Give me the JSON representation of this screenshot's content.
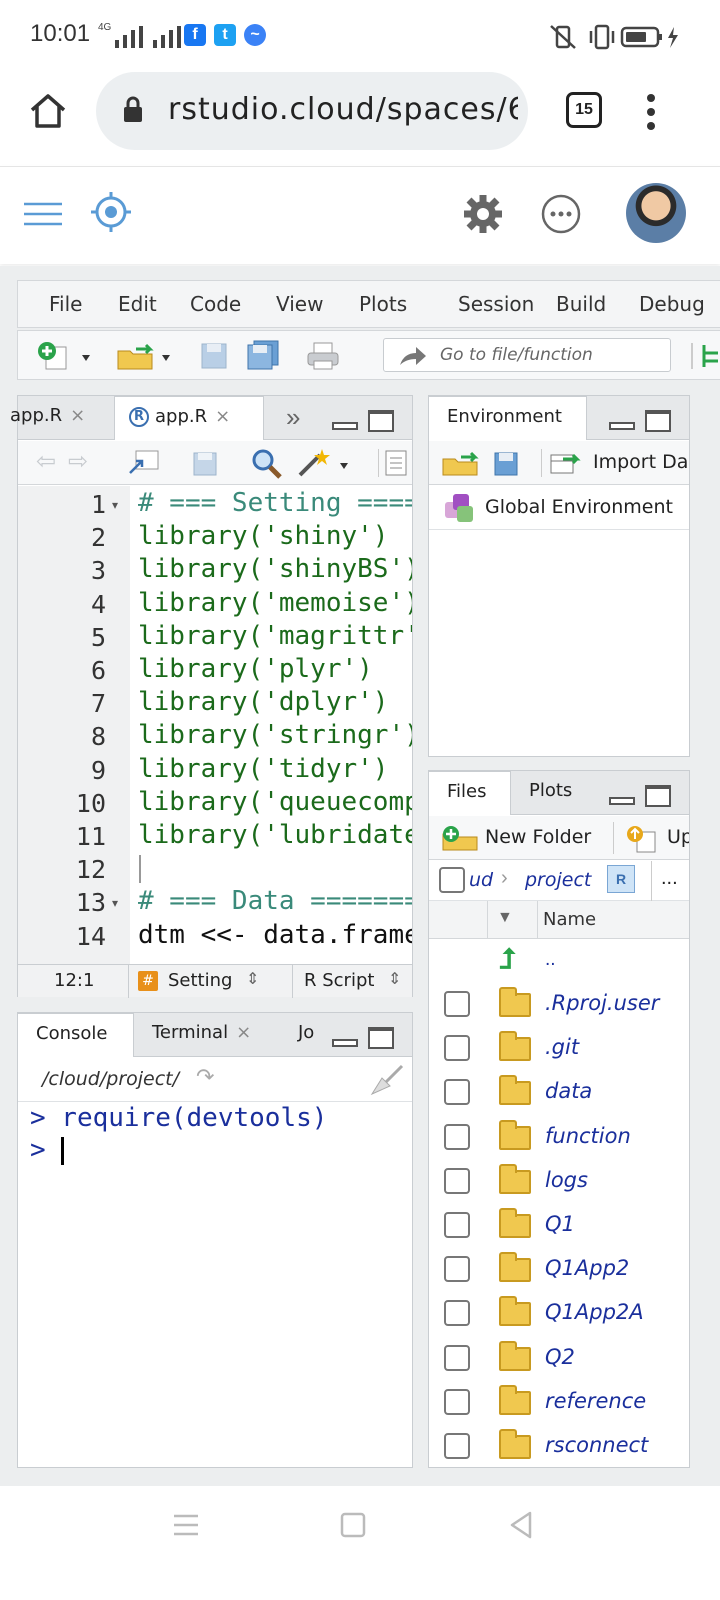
{
  "status_bar": {
    "time": "10:01",
    "network": "4G"
  },
  "browser": {
    "url": "rstudio.cloud/spaces/6(",
    "tab_count": "15"
  },
  "menu": [
    "File",
    "Edit",
    "Code",
    "View",
    "Plots",
    "Session",
    "Build",
    "Debug"
  ],
  "toolbar": {
    "goto_placeholder": "Go to file/function"
  },
  "source_tabs": [
    "app.R",
    "app.R"
  ],
  "code_lines": [
    {
      "n": "1",
      "text": "# === Setting ====",
      "type": "comment"
    },
    {
      "n": "2",
      "text": "library('shiny')",
      "type": "code"
    },
    {
      "n": "3",
      "text": "library('shinyBS')",
      "type": "code"
    },
    {
      "n": "4",
      "text": "library('memoise')",
      "type": "code"
    },
    {
      "n": "5",
      "text": "library('magrittr'",
      "type": "code"
    },
    {
      "n": "6",
      "text": "library('plyr')",
      "type": "code"
    },
    {
      "n": "7",
      "text": "library('dplyr')",
      "type": "code"
    },
    {
      "n": "8",
      "text": "library('stringr')",
      "type": "code"
    },
    {
      "n": "9",
      "text": "library('tidyr')",
      "type": "code"
    },
    {
      "n": "10",
      "text": "library('queuecomp",
      "type": "code"
    },
    {
      "n": "11",
      "text": "library('lubridate",
      "type": "code"
    },
    {
      "n": "12",
      "text": "",
      "type": "code"
    },
    {
      "n": "13",
      "text": "# === Data =======",
      "type": "comment"
    },
    {
      "n": "14",
      "text": "dtm <<- data.frame",
      "type": "plain"
    }
  ],
  "editor_status": {
    "cursor": "12:1",
    "section": "Setting",
    "filetype": "R Script"
  },
  "console": {
    "tabs": [
      "Console",
      "Terminal",
      "Jo"
    ],
    "path": "/cloud/project/",
    "lines": [
      "> require(devtools)",
      ">"
    ]
  },
  "environment": {
    "tab": "Environment",
    "import_label": "Import Da",
    "scope": "Global Environment"
  },
  "files": {
    "tabs": [
      "Files",
      "Plots"
    ],
    "new_folder": "New Folder",
    "upload": "Up",
    "breadcrumb": [
      "ud",
      "project"
    ],
    "more": "...",
    "column_name": "Name",
    "parent": "..",
    "items": [
      ".Rproj.user",
      ".git",
      "data",
      "function",
      "logs",
      "Q1",
      "Q1App2",
      "Q1App2A",
      "Q2",
      "reference",
      "rsconnect"
    ]
  }
}
